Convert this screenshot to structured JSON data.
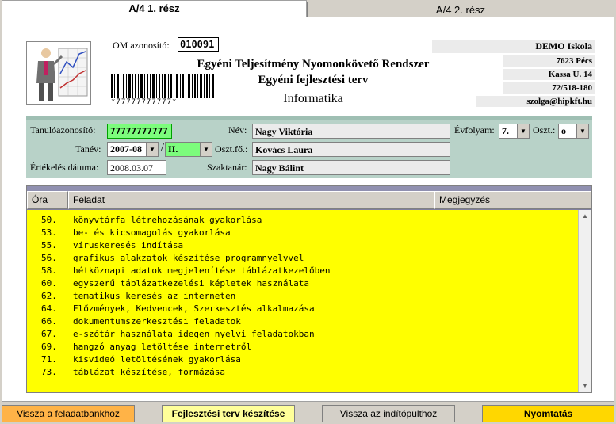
{
  "tabs": [
    {
      "label": "A/4 1. rész",
      "active": true
    },
    {
      "label": "A/4 2. rész",
      "active": false
    }
  ],
  "header": {
    "om_label": "OM azonosító:",
    "om_value": "010091",
    "title1": "Egyéni Teljesítmény Nyomonkövető Rendszer",
    "title2": "Egyéni fejlesztési terv",
    "subject": "Informatika",
    "barcode_text": "*77777777777*"
  },
  "school": {
    "name": "DEMO Iskola",
    "line1": "7623 Pécs",
    "line2": "Kassa U. 14",
    "line3": "72/518-180",
    "line4": "szolga@hipkft.hu"
  },
  "student": {
    "id_label": "Tanulóazonosító:",
    "id_value": "77777777777",
    "year_label": "Tanév:",
    "year_value": "2007-08",
    "term_value": "II.",
    "date_label": "Értékelés dátuma:",
    "date_value": "2008.03.07",
    "name_label": "Név:",
    "name_value": "Nagy Viktória",
    "head_label": "Oszt.fő.:",
    "head_value": "Kovács Laura",
    "teacher_label": "Szaktanár:",
    "teacher_value": "Nagy Bálint",
    "grade_label": "Évfolyam:",
    "grade_value": "7.",
    "class_label": "Oszt.:",
    "class_value": "o"
  },
  "table": {
    "columns": [
      "Óra",
      "Feladat",
      "Megjegyzés"
    ],
    "rows": [
      {
        "num": "50.",
        "text": "könyvtárfa létrehozásának gyakorlása"
      },
      {
        "num": "53.",
        "text": "be- és kicsomagolás gyakorlása"
      },
      {
        "num": "55.",
        "text": "víruskeresés indítása"
      },
      {
        "num": "56.",
        "text": "grafikus alakzatok készítése programnyelvvel"
      },
      {
        "num": "58.",
        "text": "hétköznapi adatok megjelenítése táblázatkezelőben"
      },
      {
        "num": "60.",
        "text": "egyszerű táblázatkezelési képletek használata"
      },
      {
        "num": "62.",
        "text": "tematikus keresés az interneten"
      },
      {
        "num": "64.",
        "text": "Előzmények, Kedvencek, Szerkesztés alkalmazása"
      },
      {
        "num": "66.",
        "text": "dokumentumszerkesztési feladatok"
      },
      {
        "num": "67.",
        "text": "e-szótár használata idegen nyelvi feladatokban"
      },
      {
        "num": "69.",
        "text": "hangzó anyag letöltése internetről"
      },
      {
        "num": "71.",
        "text": "kisvideó letöltésének gyakorlása"
      },
      {
        "num": "73.",
        "text": "táblázat készítése, formázása"
      }
    ]
  },
  "buttons": {
    "back_bank": "Vissza a feladatbankhoz",
    "create_plan": "Fejlesztési terv készítése",
    "back_start": "Vissza az indítópulthoz",
    "print": "Nyomtatás"
  },
  "colors": {
    "id_field": "#7cfc7c",
    "table_bg": "#ffff00",
    "info_bg": "#b8d2c8",
    "btn_back": "#ffb347",
    "btn_create": "#ffff99",
    "btn_print": "#ffd700"
  }
}
